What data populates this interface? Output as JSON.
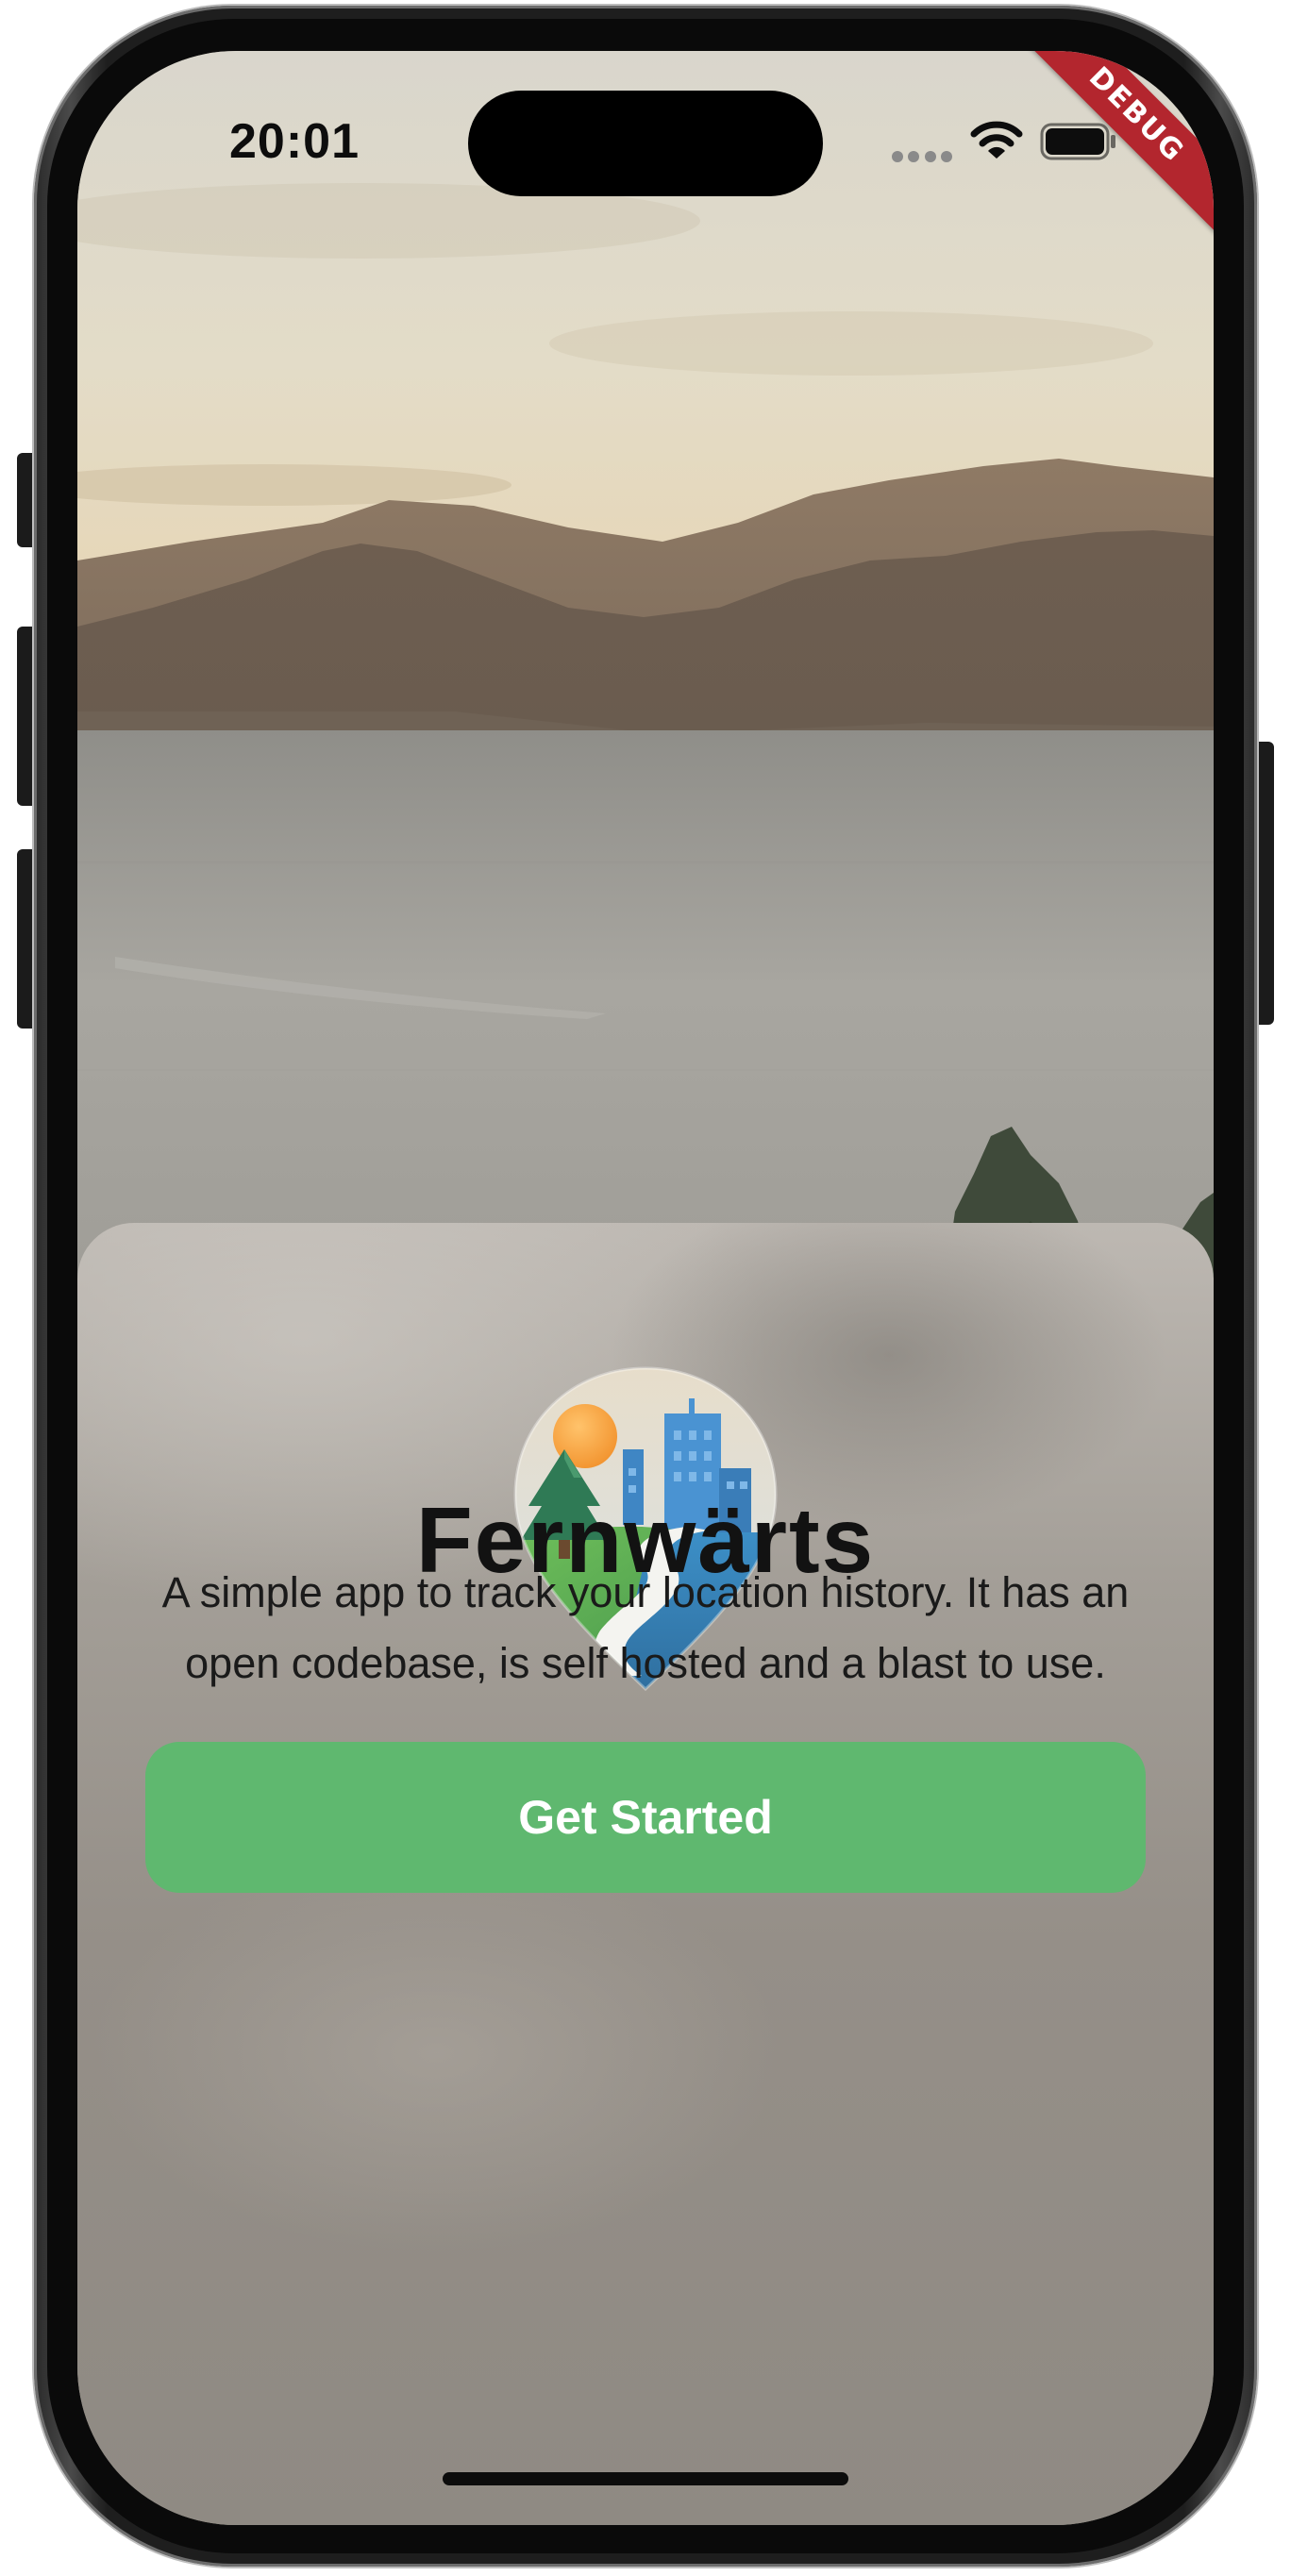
{
  "status_bar": {
    "time": "20:01",
    "debug_banner": "DEBUG",
    "icons": [
      "signal-icon",
      "wifi-icon",
      "battery-icon"
    ]
  },
  "onboarding": {
    "logo_icon": "map-pin-landscape-icon",
    "title": "Fernwärts",
    "description": "A simple app to track your location history. It has an open codebase, is self hosted and a blast to use.",
    "get_started_label": "Get Started"
  },
  "colors": {
    "primary_button": "#5fb86f",
    "debug_banner": "#b3262e",
    "title_text": "#121212"
  }
}
